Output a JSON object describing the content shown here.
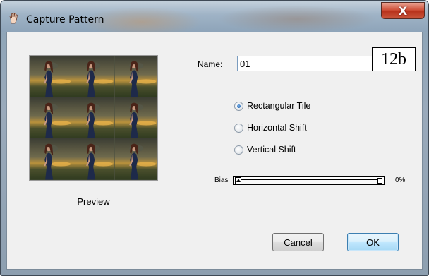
{
  "window": {
    "title": "Capture Pattern",
    "close_glyph": "X"
  },
  "preview": {
    "label": "Preview",
    "tiles": 9
  },
  "name_field": {
    "label": "Name:",
    "value": "01"
  },
  "tag": "12b",
  "tile_options": [
    {
      "label": "Rectangular Tile",
      "checked": true
    },
    {
      "label": "Horizontal Shift",
      "checked": false
    },
    {
      "label": "Vertical Shift",
      "checked": false
    }
  ],
  "bias": {
    "label": "Bias",
    "value_text": "0%",
    "value": 0
  },
  "buttons": {
    "cancel": "Cancel",
    "ok": "OK"
  },
  "colors": {
    "radio_selected": "#2b6cb8",
    "ok_border": "#3c7fb1",
    "close_red": "#c9563c"
  }
}
